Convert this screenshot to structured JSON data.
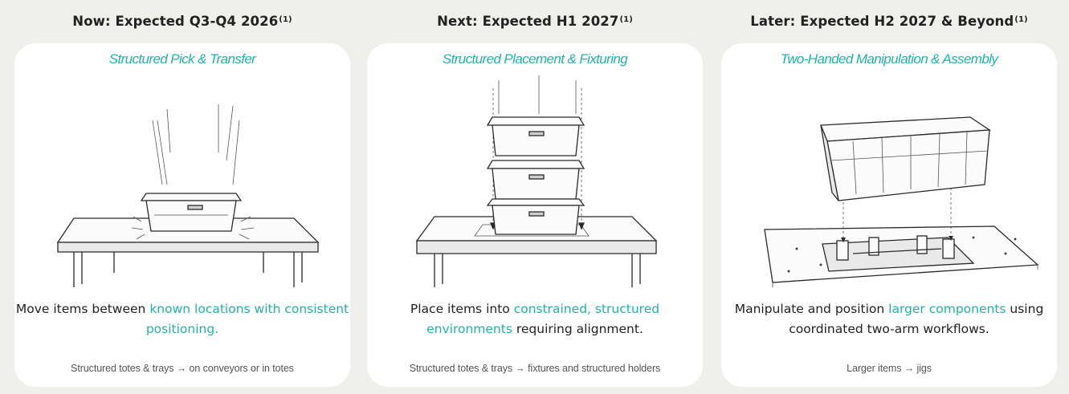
{
  "columns": [
    {
      "heading": "Now: Expected Q3-Q4 2026",
      "heading_note": "(1)",
      "subtitle": "Structured Pick & Transfer",
      "desc_pre": "Move items between ",
      "desc_hl": "known locations with consistent positioning.",
      "desc_post": "",
      "footer": "Structured totes & trays → on conveyors or in totes",
      "illustration": "single-tote-on-table"
    },
    {
      "heading": "Next: Expected H1 2027",
      "heading_note": "(1)",
      "subtitle": "Structured Placement & Fixturing",
      "desc_pre": "Place items into ",
      "desc_hl": "constrained, structured environments",
      "desc_post": " requiring alignment.",
      "footer": "Structured totes & trays → fixtures and structured holders",
      "illustration": "stacked-totes-on-table"
    },
    {
      "heading": "Later: Expected H2 2027 & Beyond",
      "heading_note": "(1)",
      "subtitle": "Two-Handed Manipulation & Assembly",
      "desc_pre": "Manipulate and position ",
      "desc_hl": "larger components",
      "desc_post": " using coordinated two-arm workflows.",
      "footer": "Larger items → jigs",
      "illustration": "large-crate-over-jig"
    }
  ],
  "colors": {
    "background": "#efefec",
    "card": "#ffffff",
    "accent": "#1fb5a8",
    "text": "#222222"
  }
}
